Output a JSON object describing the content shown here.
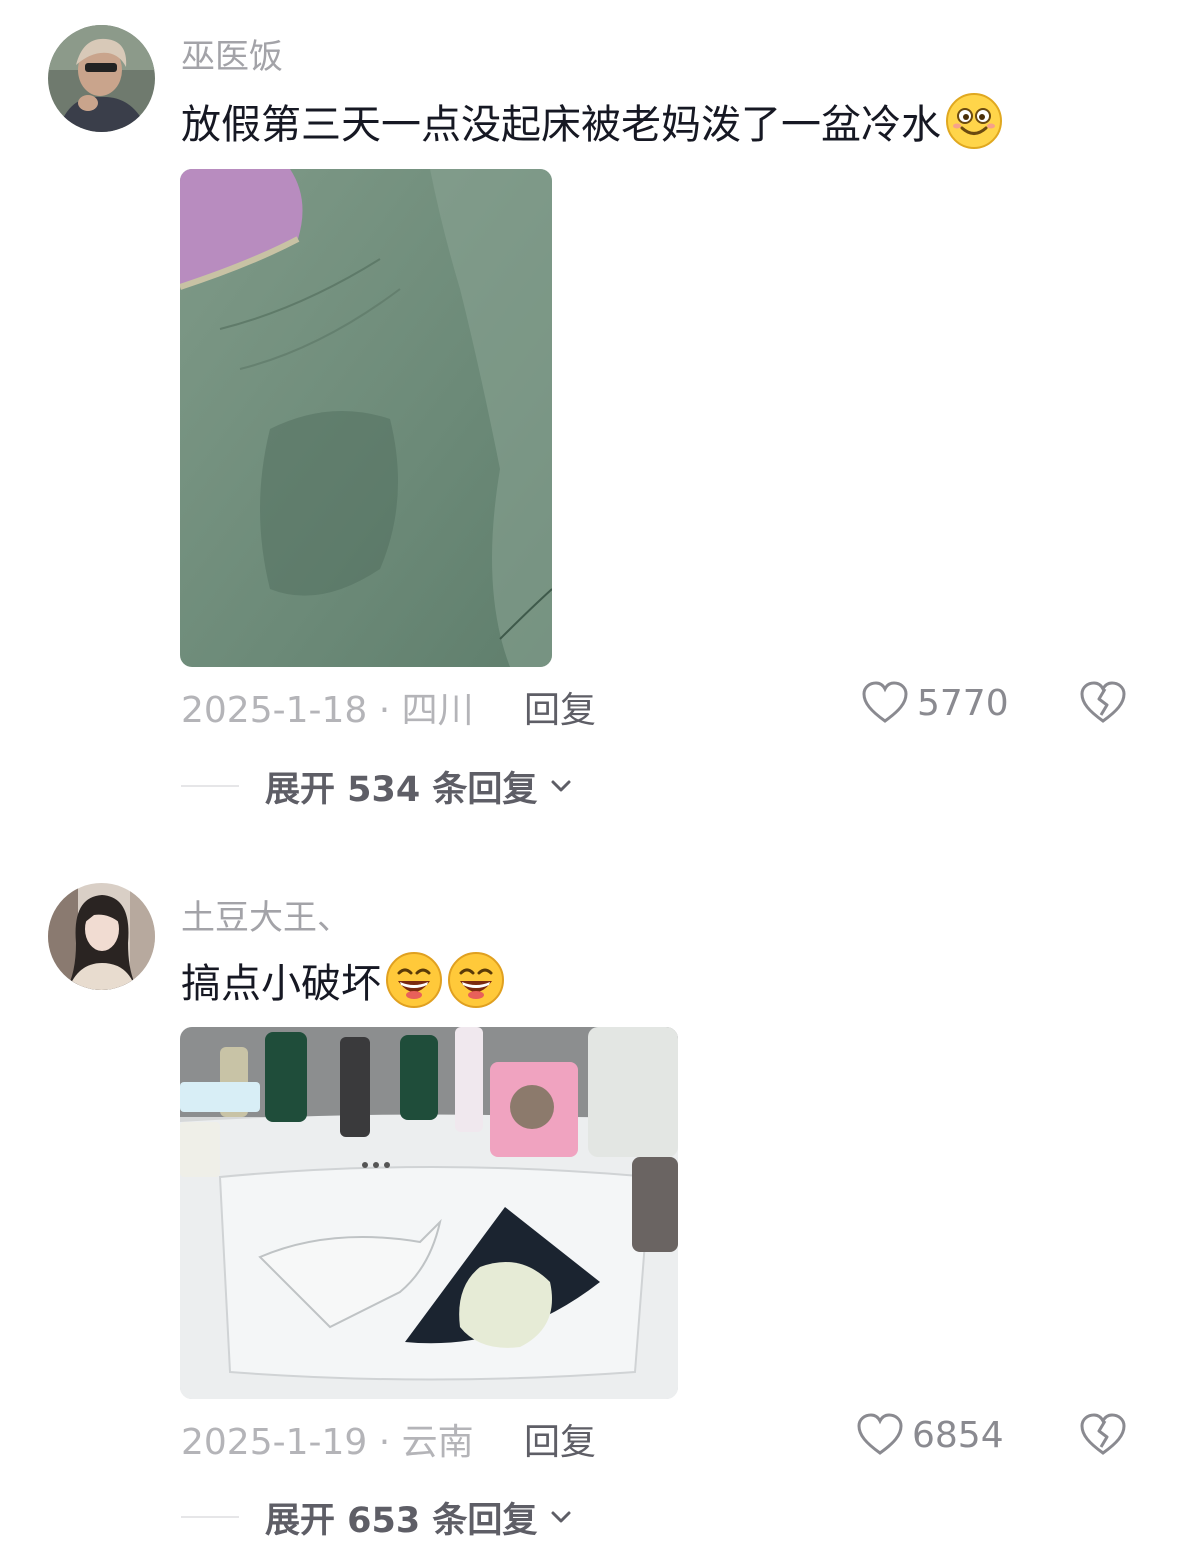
{
  "comments": [
    {
      "username": "巫医饭",
      "text": "放假第三天一点没起床被老妈泼了一盆冷水",
      "emoji_names": [
        "smile-emoji"
      ],
      "date_location": "2025-1-18 · 四川",
      "reply_label": "回复",
      "like_count": "5770",
      "expand_label": "展开 534 条回复"
    },
    {
      "username": "土豆大王、",
      "text": "搞点小破坏",
      "emoji_names": [
        "grin-emoji",
        "grin-emoji"
      ],
      "date_location": "2025-1-19 · 云南",
      "reply_label": "回复",
      "like_count": "6854",
      "expand_label": "展开 653 条回复"
    }
  ],
  "colors": {
    "username": "#a3a3a8",
    "meta": "#b4b4b8",
    "action": "#5e5e66",
    "bedsheet": "#6e8c7a",
    "pillow": "#b88cbf",
    "sink": "#e9ebec"
  }
}
